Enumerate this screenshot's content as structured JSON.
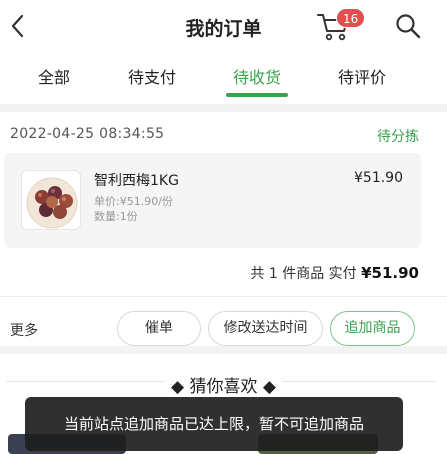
{
  "header": {
    "title": "我的订单",
    "cart_badge": "16",
    "back_icon": "chevron-left-icon",
    "cart_icon": "cart-icon",
    "search_icon": "search-icon"
  },
  "tabs": [
    {
      "label": "全部",
      "active": false
    },
    {
      "label": "待支付",
      "active": false
    },
    {
      "label": "待收货",
      "active": true
    },
    {
      "label": "待评价",
      "active": false
    }
  ],
  "order": {
    "time": "2022-04-25 08:34:55",
    "status": "待分拣",
    "product": {
      "name": "智利西梅1KG",
      "unit_price": "单价:¥51.90/份",
      "quantity": "数量:1份",
      "price": "¥51.90"
    },
    "summary_prefix": "共 1 件商品  实付",
    "total": "¥51.90",
    "more_label": "更多",
    "buttons": {
      "urge": "催单",
      "change_time": "修改送达时间",
      "add_item": "加商品"
    },
    "add_item_button_text": "追加商品"
  },
  "recommend": {
    "title": "猜你喜欢"
  },
  "toast": {
    "message": "当前站点追加商品已达上限，暂不可追加商品"
  },
  "colors": {
    "accent": "#38a24c",
    "badge": "#e24f4f"
  }
}
